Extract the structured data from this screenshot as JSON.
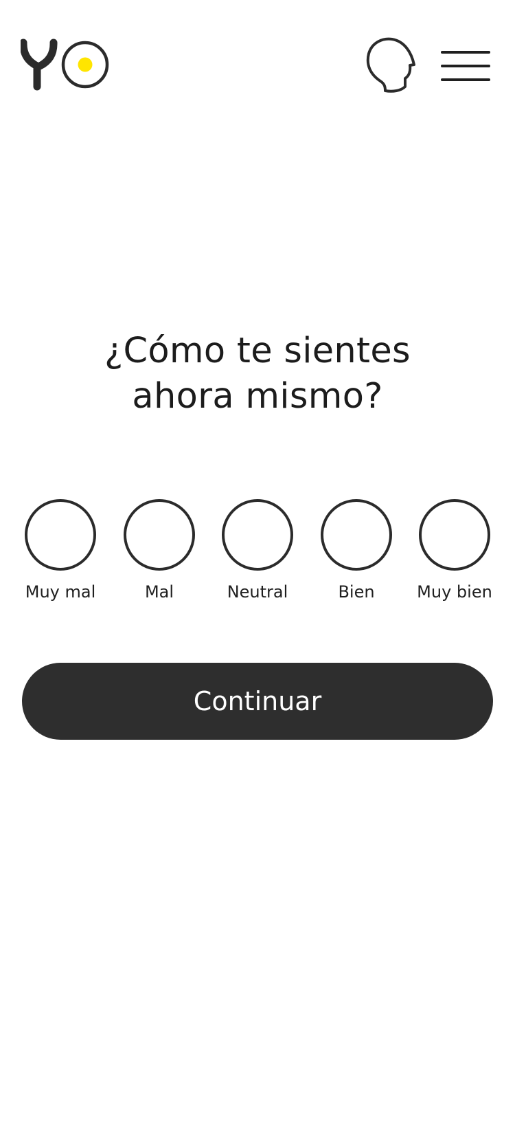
{
  "header": {
    "logo_text": "YO",
    "logo_accent_color": "#FFE500",
    "logo_icon": "yo-logo",
    "head_icon": "head-profile-icon",
    "menu_icon": "hamburger-menu-icon"
  },
  "main": {
    "question": "¿Cómo te sientes\nahora mismo?",
    "moods": [
      {
        "label": "Muy mal"
      },
      {
        "label": "Mal"
      },
      {
        "label": "Neutral"
      },
      {
        "label": "Bien"
      },
      {
        "label": "Muy bien"
      }
    ],
    "continue_label": "Continuar"
  },
  "colors": {
    "text": "#1C1C1C",
    "button": "#2E2E2E",
    "button_text": "#FFFFFF",
    "circle_border": "#2B2B2B",
    "background": "#FFFFFF"
  }
}
